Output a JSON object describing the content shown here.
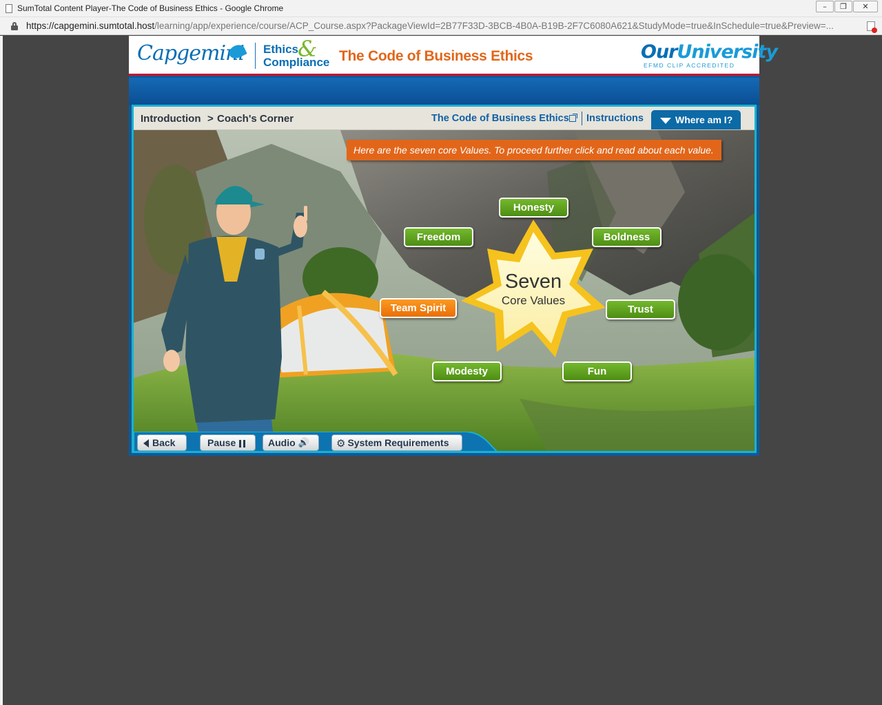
{
  "browser": {
    "title": "SumTotal Content Player-The Code of Business Ethics - Google Chrome",
    "url_host": "https://capgemini.sumtotal.host",
    "url_path": "/learning/app/experience/course/ACP_Course.aspx?PackageViewId=2B77F33D-3BCB-4B0A-B19B-2F7C6080A621&StudyMode=true&InSchedule=true&Preview=..."
  },
  "header": {
    "brand": "Capgemini",
    "ethics": "Ethics",
    "amp": "&",
    "compliance": "Compliance",
    "course_title": "The Code of Business Ethics",
    "university_our": "Our",
    "university_uni": "University",
    "accreditation": "EFMD CLIP ACCREDITED"
  },
  "breadcrumb": {
    "intro": "Introduction",
    "separator": ">",
    "current": "Coach's Corner"
  },
  "toplinks": {
    "code": "The Code of Business Ethics",
    "instructions": "Instructions",
    "where": "Where am I?"
  },
  "banner": "Here are the seven core Values. To proceed further click and read about each value.",
  "star": {
    "line1": "Seven",
    "line2": "Core Values"
  },
  "values": {
    "honesty": "Honesty",
    "freedom": "Freedom",
    "boldness": "Boldness",
    "team_spirit": "Team Spirit",
    "trust": "Trust",
    "modesty": "Modesty",
    "fun": "Fun"
  },
  "nav": {
    "back": "Back",
    "pause": "Pause",
    "audio": "Audio",
    "sysreq": "System Requirements"
  },
  "colors": {
    "accent_orange": "#e2661a",
    "value_green": "#5f9f1d",
    "active_orange": "#f28a12",
    "brand_blue": "#0a6eb4"
  }
}
